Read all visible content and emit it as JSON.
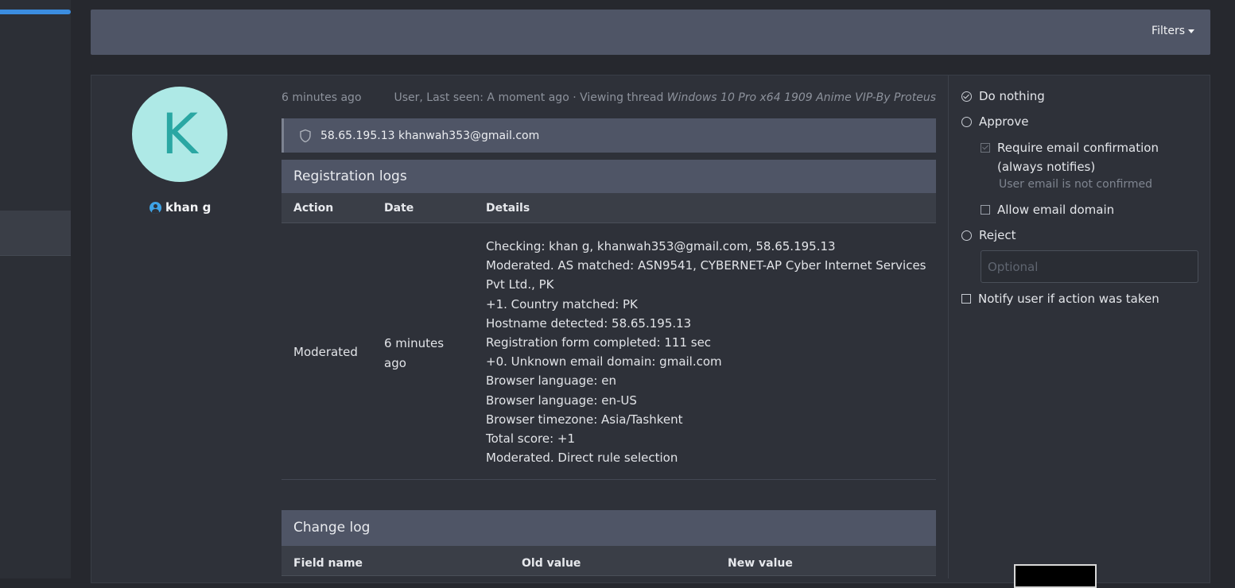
{
  "toolbar": {
    "filters_label": "Filters"
  },
  "user": {
    "avatar_letter": "K",
    "name": "khan g"
  },
  "meta": {
    "time": "6 minutes ago",
    "status_prefix": "User, Last seen: A moment ago · Viewing thread",
    "thread_title": "Windows 10 Pro x64 1909 Anime VIP-By Proteus"
  },
  "ip_info": "58.65.195.13 khanwah353@gmail.com",
  "registration_logs": {
    "title": "Registration logs",
    "columns": [
      "Action",
      "Date",
      "Details"
    ],
    "rows": [
      {
        "action": "Moderated",
        "date": "6 minutes ago",
        "details": [
          "Checking: khan g, khanwah353@gmail.com, 58.65.195.13",
          "Moderated. AS matched: ASN9541, CYBERNET-AP Cyber Internet Services Pvt Ltd., PK",
          "+1. Country matched: PK",
          "Hostname detected: 58.65.195.13",
          "Registration form completed: 111 sec",
          "+0. Unknown email domain: gmail.com",
          "Browser language: en",
          "Browser language: en-US",
          "Browser timezone: Asia/Tashkent",
          "Total score: +1",
          "Moderated. Direct rule selection"
        ]
      }
    ]
  },
  "change_log": {
    "title": "Change log",
    "columns": [
      "Field name",
      "Old value",
      "New value"
    ]
  },
  "actions": {
    "do_nothing": "Do nothing",
    "approve": "Approve",
    "require_email": "Require email confirmation (always notifies)",
    "email_hint": "User email is not confirmed",
    "allow_domain": "Allow email domain",
    "reject": "Reject",
    "reject_placeholder": "Optional",
    "notify": "Notify user if action was taken"
  }
}
